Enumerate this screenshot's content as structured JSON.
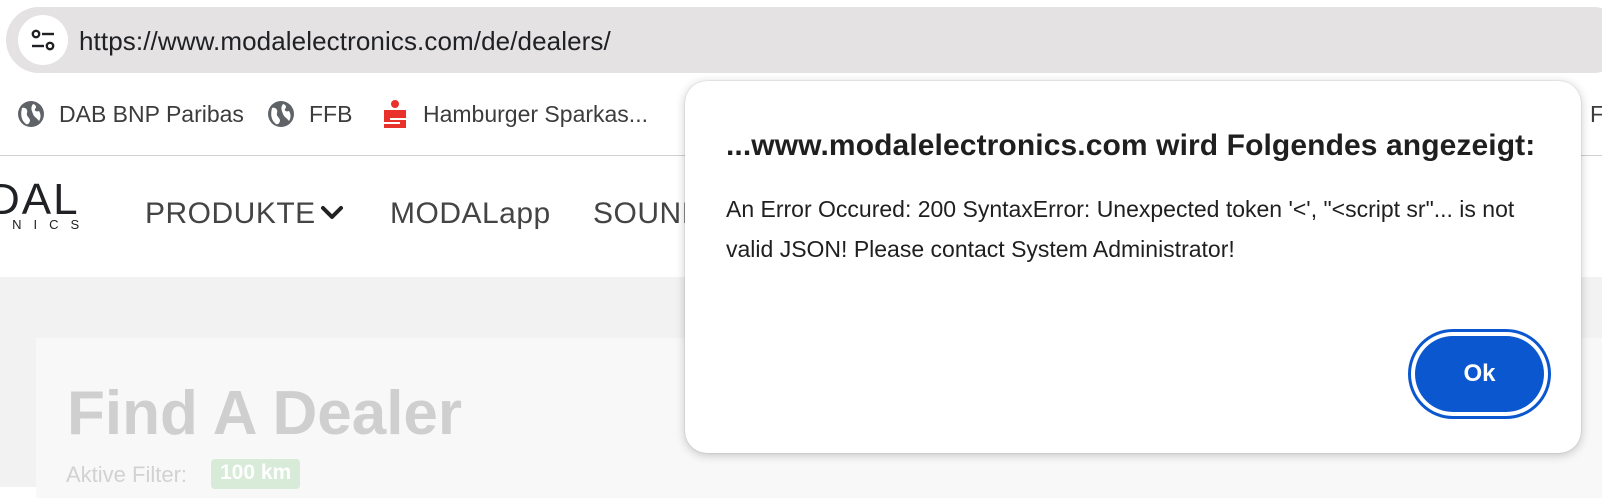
{
  "browser": {
    "url": "https://www.modalelectronics.com/de/dealers/",
    "bookmarks": [
      {
        "label": "DAB BNP Paribas",
        "icon": "globe-icon"
      },
      {
        "label": "FFB",
        "icon": "globe-icon"
      },
      {
        "label": "Hamburger Sparkas...",
        "icon": "sparkasse-icon"
      },
      {
        "label": "F",
        "icon": ""
      }
    ],
    "colors": {
      "omnibox": "#e4e2e3",
      "sparkasse": "#e8312a",
      "globe": "#5f6368"
    }
  },
  "site": {
    "logo_top": "DAL",
    "logo_bottom": "ONICS",
    "nav": [
      {
        "label": "PRODUKTE"
      },
      {
        "label": "MODALapp"
      },
      {
        "label": "SOUNI"
      }
    ],
    "page_title": "Find A Dealer",
    "filter_label": "Aktive Filter:",
    "filter_badge": "100 km"
  },
  "dialog": {
    "title": "...www.modalelectronics.com wird Folgendes angezeigt:",
    "message": "An Error Occured: 200 SyntaxError: Unexpected token '<', \"<script sr\"... is not valid JSON! Please contact System Administrator!",
    "ok_label": "Ok",
    "accent": "#0b57d0"
  }
}
